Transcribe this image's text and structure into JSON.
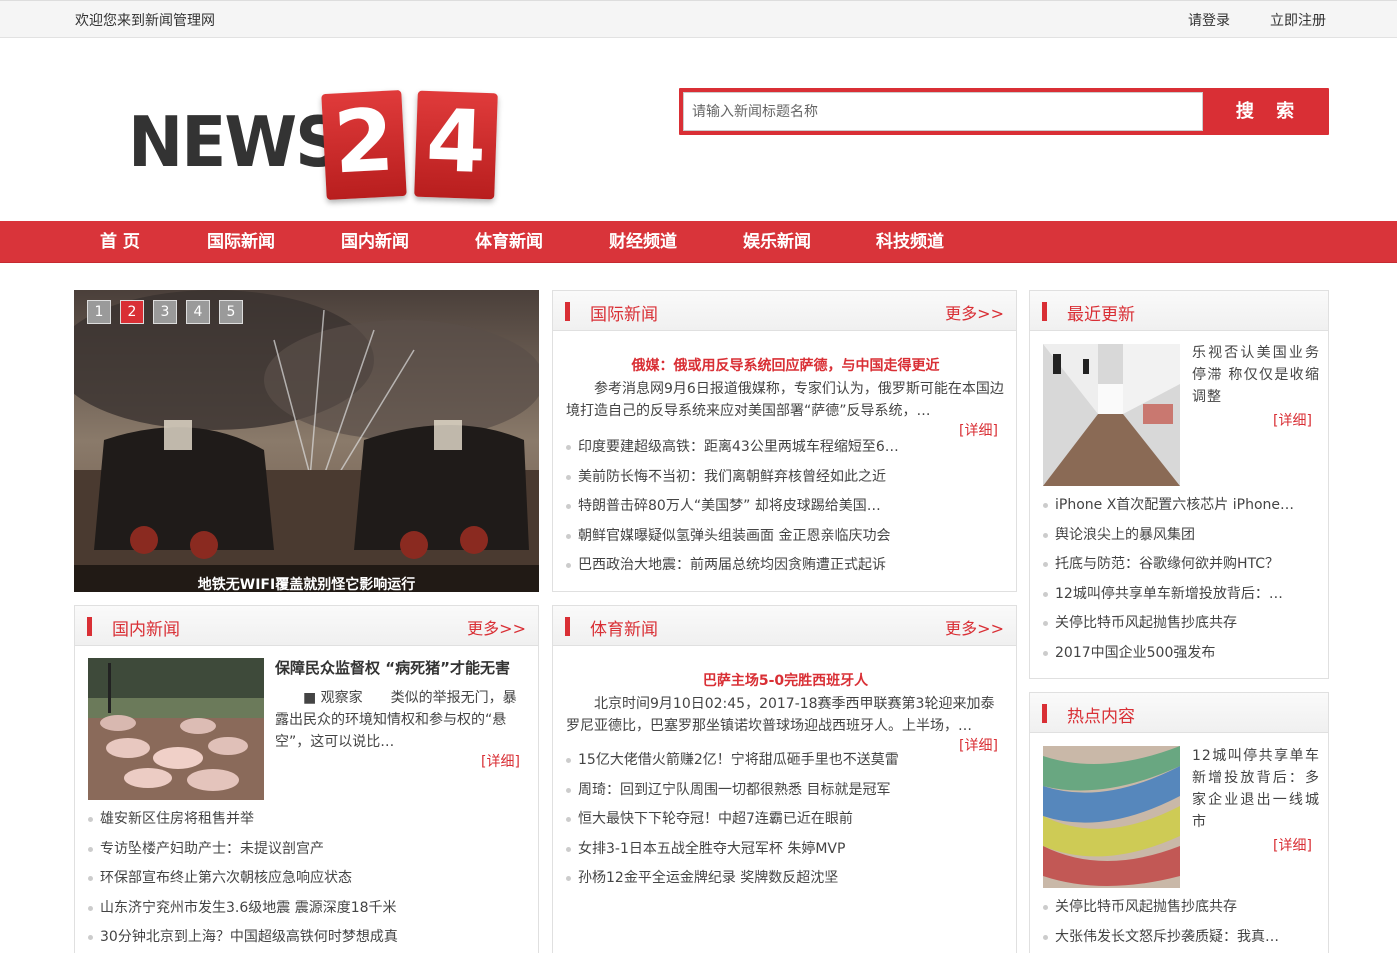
{
  "topbar": {
    "welcome": "欢迎您来到新闻管理网",
    "login": "请登录",
    "register": "立即注册"
  },
  "logo": {
    "text": "NEWS",
    "digits": [
      "2",
      "4"
    ]
  },
  "search": {
    "placeholder": "请输入新闻标题名称",
    "button": "搜 索"
  },
  "nav": [
    "首 页",
    "国际新闻",
    "国内新闻",
    "体育新闻",
    "财经频道",
    "娱乐新闻",
    "科技频道"
  ],
  "slider": {
    "pages": [
      "1",
      "2",
      "3",
      "4",
      "5"
    ],
    "active_page": "2",
    "caption": "地铁无WIFI覆盖就别怪它影响运行"
  },
  "international": {
    "title": "国际新闻",
    "more": "更多>>",
    "headline": "俄媒：俄或用反导系统回应萨德，与中国走得更近",
    "summary": "参考消息网9月6日报道俄媒称，专家们认为，俄罗斯可能在本国边境打造自己的反导系统来应对美国部署“萨德”反导系统，…",
    "detail": "[详细]",
    "items": [
      "印度要建超级高铁：距离43公里两城车程缩短至6…",
      "美前防长悔不当初：我们离朝鲜弃核曾经如此之近",
      "特朗普击碎80万人“美国梦” 却将皮球踢给美国…",
      "朝鲜官媒曝疑似氢弹头组装画面 金正恩亲临庆功会",
      "巴西政治大地震：前两届总统均因贪贿遭正式起诉"
    ]
  },
  "recent": {
    "title": "最近更新",
    "feature_text": "乐视否认美国业务停滞 称仅仅是收缩调整",
    "detail": "[详细]",
    "items": [
      "iPhone X首次配置六核芯片 iPhone…",
      "舆论浪尖上的暴风集团",
      "托底与防范：谷歌缘何欲并购HTC？",
      "12城叫停共享单车新增投放背后：…",
      "关停比特币风起抛售抄底共存",
      "2017中国企业500强发布"
    ]
  },
  "domestic": {
    "title": "国内新闻",
    "more": "更多>>",
    "feature_title": "保障民众监督权 “病死猪”才能无害",
    "feature_text": "■ 观察家　　类似的举报无门，暴露出民众的环境知情权和参与权的“悬空”，这可以说比…",
    "detail": "[详细]",
    "items": [
      "雄安新区住房将租售并举",
      "专访坠楼产妇助产士：未提议剖宫产",
      "环保部宣布终止第六次朝核应急响应状态",
      "山东济宁兖州市发生3.6级地震 震源深度18千米",
      "30分钟北京到上海？中国超级高铁何时梦想成真"
    ]
  },
  "sports": {
    "title": "体育新闻",
    "more": "更多>>",
    "headline": "巴萨主场5-0完胜西班牙人",
    "summary": "北京时间9月10日02:45，2017-18赛季西甲联赛第3轮迎来加泰罗尼亚德比，巴塞罗那坐镇诺坎普球场迎战西班牙人。上半场，…",
    "detail": "[详细]",
    "items": [
      "15亿大佬借火箭赚2亿！宁将甜瓜砸手里也不送莫雷",
      "周琦：回到辽宁队周围一切都很熟悉 目标就是冠军",
      "恒大最快下下轮夺冠！中超7连霸已近在眼前",
      "女排3-1日本五战全胜夺大冠军杯 朱婷MVP",
      "孙杨12金平全运金牌纪录 奖牌数反超沈坚"
    ]
  },
  "hot": {
    "title": "热点内容",
    "feature_text": "12城叫停共享单车新增投放背后：多家企业退出一线城市",
    "detail": "[详细]",
    "items": [
      "关停比特币风起抛售抄底共存",
      "大张伟发长文怒斥抄袭质疑：我真…"
    ]
  }
}
